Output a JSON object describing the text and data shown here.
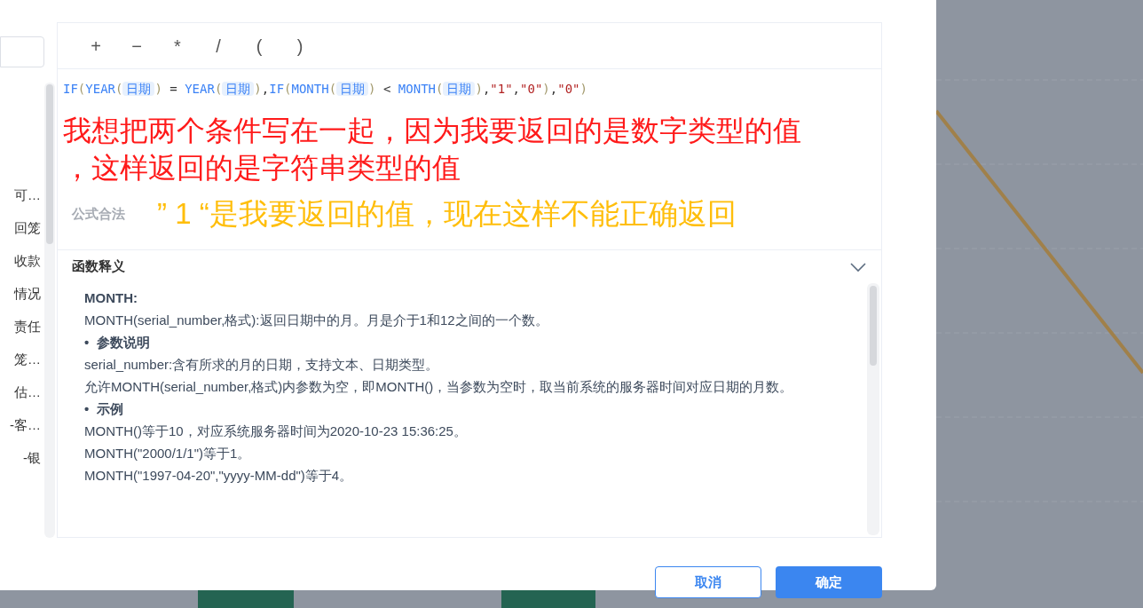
{
  "sidebar": {
    "items": [
      {
        "label": "可…"
      },
      {
        "label": "回笼"
      },
      {
        "label": "收款"
      },
      {
        "label": "情况"
      },
      {
        "label": "责任"
      },
      {
        "label": "笼…"
      },
      {
        "label": "估…"
      },
      {
        "label": "-客…"
      },
      {
        "label": "-银"
      }
    ]
  },
  "operators": [
    "+",
    "−",
    "*",
    "/",
    "(",
    ")"
  ],
  "formula": [
    {
      "kind": "func",
      "text": "IF"
    },
    {
      "kind": "paren",
      "text": "("
    },
    {
      "kind": "func",
      "text": "YEAR"
    },
    {
      "kind": "paren",
      "text": "("
    },
    {
      "kind": "field",
      "text": "日期"
    },
    {
      "kind": "paren",
      "text": ")"
    },
    {
      "kind": "op",
      "text": " = "
    },
    {
      "kind": "func",
      "text": "YEAR"
    },
    {
      "kind": "paren",
      "text": "("
    },
    {
      "kind": "field",
      "text": "日期"
    },
    {
      "kind": "paren",
      "text": ")"
    },
    {
      "kind": "op",
      "text": ","
    },
    {
      "kind": "func",
      "text": "IF"
    },
    {
      "kind": "paren",
      "text": "("
    },
    {
      "kind": "func",
      "text": "MONTH"
    },
    {
      "kind": "paren",
      "text": "("
    },
    {
      "kind": "field",
      "text": "日期"
    },
    {
      "kind": "paren",
      "text": ")"
    },
    {
      "kind": "op",
      "text": " < "
    },
    {
      "kind": "func",
      "text": "MONTH"
    },
    {
      "kind": "paren",
      "text": "("
    },
    {
      "kind": "field",
      "text": "日期"
    },
    {
      "kind": "paren",
      "text": ")"
    },
    {
      "kind": "op",
      "text": ","
    },
    {
      "kind": "string",
      "text": "\"1\""
    },
    {
      "kind": "op",
      "text": ","
    },
    {
      "kind": "string",
      "text": "\"0\""
    },
    {
      "kind": "paren",
      "text": ")"
    },
    {
      "kind": "op",
      "text": ","
    },
    {
      "kind": "string",
      "text": "\"0\""
    },
    {
      "kind": "paren",
      "text": ")"
    }
  ],
  "annotation_red": [
    "我想把两个条件写在一起，因为我要返回的是数字类型的值",
    "，这样返回的是字符串类型的值"
  ],
  "validity": "公式合法",
  "annotation_yellow": "” 1 “是我要返回的值，现在这样不能正确返回",
  "help": {
    "title": "函数释义",
    "expanded": true,
    "lines": [
      {
        "kind": "title",
        "text": "MONTH:"
      },
      {
        "kind": "text",
        "text": "MONTH(serial_number,格式):返回日期中的月。月是介于1和12之间的一个数。"
      },
      {
        "kind": "bullet",
        "marker": "•",
        "text": "参数说明"
      },
      {
        "kind": "text",
        "text": "serial_number:含有所求的月的日期，支持文本、日期类型。"
      },
      {
        "kind": "text",
        "text": "允许MONTH(serial_number,格式)内参数为空，即MONTH()，当参数为空时，取当前系统的服务器时间对应日期的月数。"
      },
      {
        "kind": "bullet",
        "marker": "•",
        "text": "示例"
      },
      {
        "kind": "text",
        "text": "MONTH()等于10，对应系统服务器时间为2020-10-23 15:36:25。"
      },
      {
        "kind": "text",
        "text": "MONTH(\"2000/1/1\")等于1。"
      },
      {
        "kind": "text",
        "text": "MONTH(\"1997-04-20\",\"yyyy-MM-dd\")等于4。"
      }
    ]
  },
  "buttons": [
    {
      "label": "取消",
      "kind": "secondary"
    },
    {
      "label": "确定",
      "kind": "primary"
    }
  ]
}
